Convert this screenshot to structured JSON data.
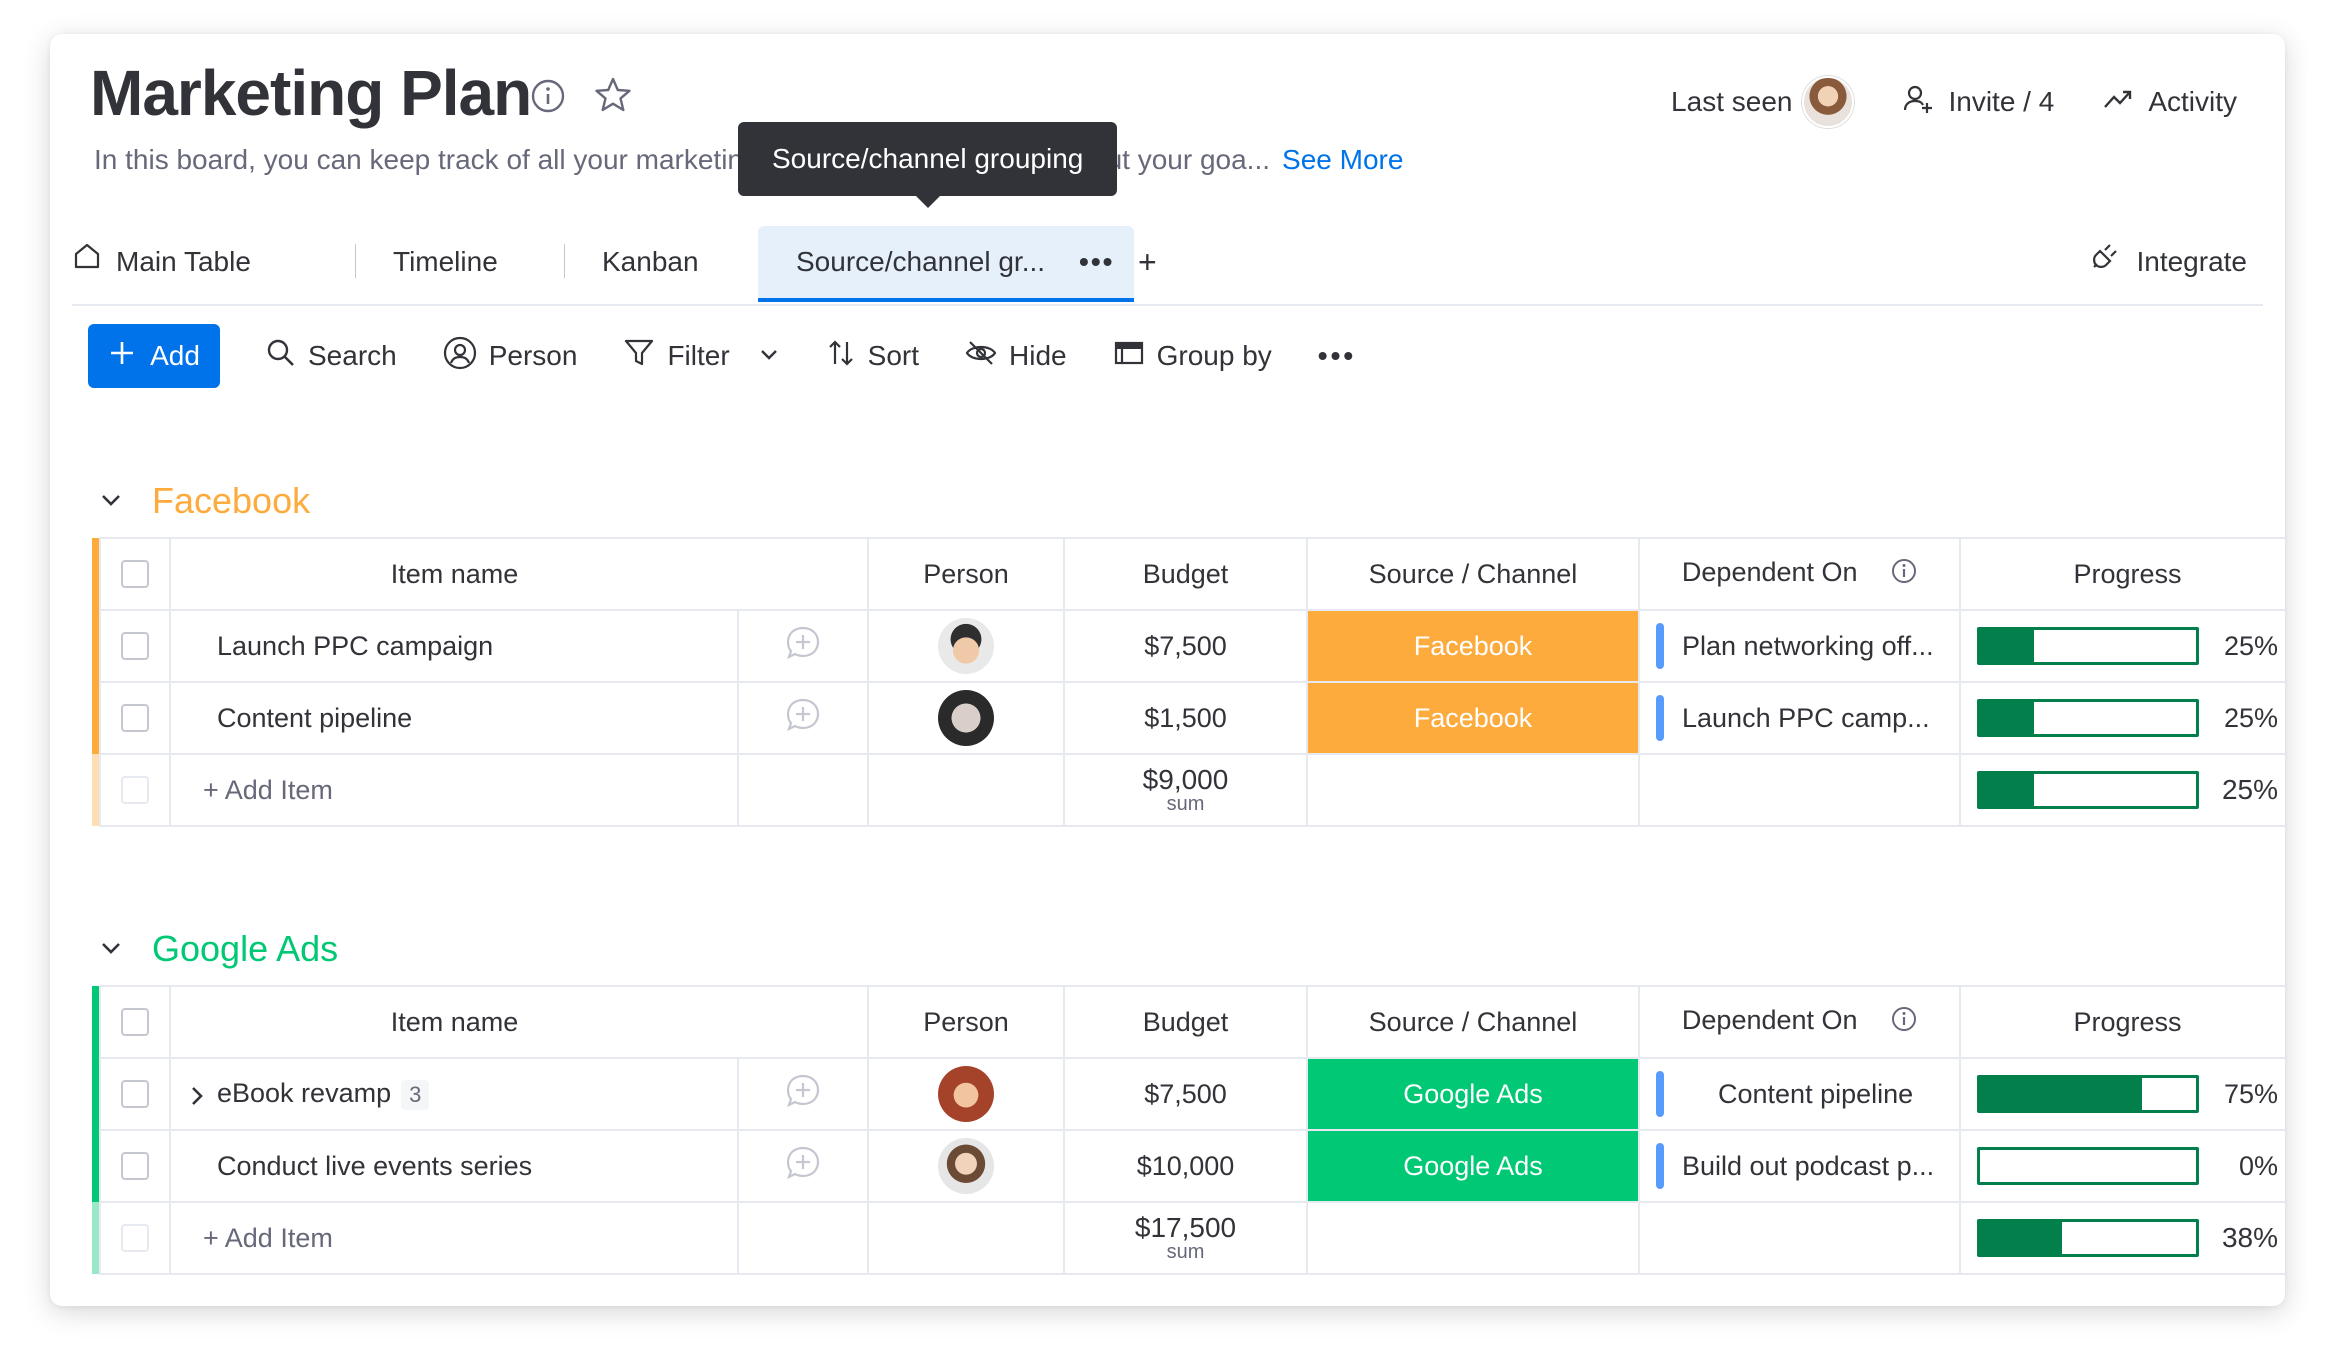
{
  "board": {
    "title": "Marketing Plan",
    "description_start": "In this board, you can keep track of all your marketin",
    "description_end": "out your goa...",
    "see_more": "See More"
  },
  "header_actions": {
    "last_seen": "Last seen",
    "invite": "Invite / 4",
    "activity": "Activity"
  },
  "tooltip": "Source/channel grouping",
  "tabs": [
    {
      "label": "Main Table"
    },
    {
      "label": "Timeline"
    },
    {
      "label": "Kanban"
    },
    {
      "label": "Source/channel gr..."
    }
  ],
  "tab_more": "•••",
  "tab_add": "+",
  "integrate": "Integrate",
  "toolbar": {
    "add": "Add",
    "search": "Search",
    "person": "Person",
    "filter": "Filter",
    "sort": "Sort",
    "hide": "Hide",
    "group_by": "Group by",
    "more": "•••"
  },
  "columns": {
    "item": "Item name",
    "person": "Person",
    "budget": "Budget",
    "source": "Source / Channel",
    "dependent": "Dependent On",
    "progress": "Progress"
  },
  "groups": [
    {
      "title": "Facebook",
      "color": "#fdab3d",
      "rows": [
        {
          "name": "Launch PPC campaign",
          "budget": "$7,500",
          "source": "Facebook",
          "dependent": "Plan networking off...",
          "progress_label": "25%",
          "progress": 0.25
        },
        {
          "name": "Content pipeline",
          "budget": "$1,500",
          "source": "Facebook",
          "dependent": "Launch PPC camp...",
          "progress_label": "25%",
          "progress": 0.25
        }
      ],
      "add_item": "+ Add Item",
      "sum": "$9,000",
      "sum_label": "sum",
      "total_progress_label": "25%",
      "total_progress": 0.25
    },
    {
      "title": "Google Ads",
      "color": "#00c875",
      "rows": [
        {
          "name": "eBook revamp",
          "subitems": "3",
          "budget": "$7,500",
          "source": "Google Ads",
          "dependent": "Content pipeline",
          "progress_label": "75%",
          "progress": 0.75
        },
        {
          "name": "Conduct live events series",
          "budget": "$10,000",
          "source": "Google Ads",
          "dependent": "Build out podcast p...",
          "progress_label": "0%",
          "progress": 0.0
        }
      ],
      "add_item": "+ Add Item",
      "sum": "$17,500",
      "sum_label": "sum",
      "total_progress_label": "38%",
      "total_progress": 0.38
    }
  ]
}
